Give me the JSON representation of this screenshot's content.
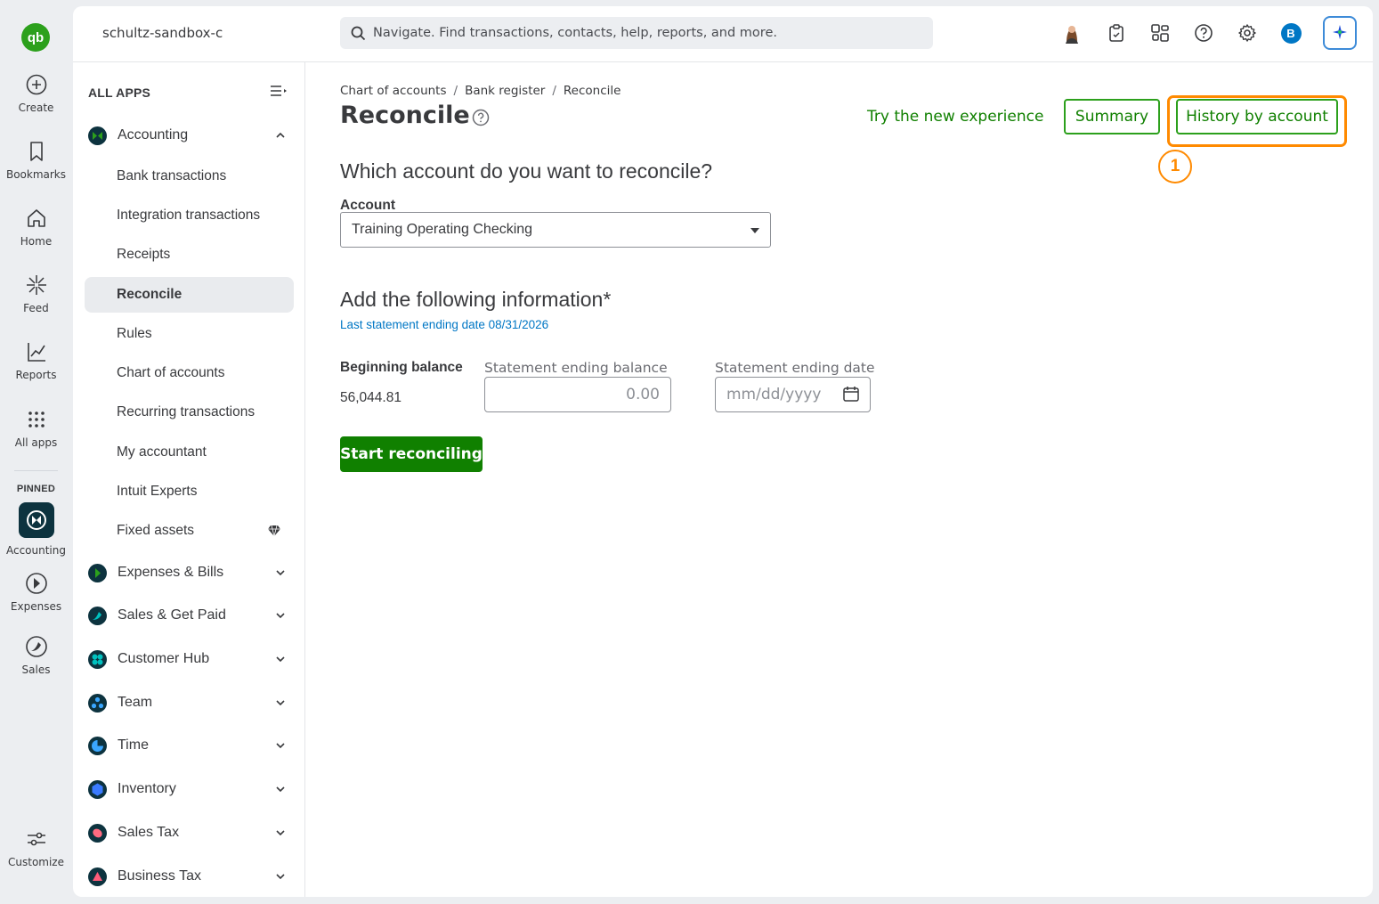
{
  "rail": {
    "logo": "qb",
    "items": [
      {
        "label": "Create",
        "icon": "plus-circle-icon"
      },
      {
        "label": "Bookmarks",
        "icon": "bookmark-icon"
      },
      {
        "label": "Home",
        "icon": "home-icon"
      },
      {
        "label": "Feed",
        "icon": "feed-icon"
      },
      {
        "label": "Reports",
        "icon": "reports-icon"
      },
      {
        "label": "All apps",
        "icon": "grid-icon"
      }
    ],
    "pinned_label": "PINNED",
    "pinned": [
      {
        "label": "Accounting",
        "icon": "accounting-icon"
      },
      {
        "label": "Expenses",
        "icon": "expenses-icon"
      },
      {
        "label": "Sales",
        "icon": "sales-icon"
      }
    ],
    "customize_label": "Customize"
  },
  "topbar": {
    "company": "schultz-sandbox-c",
    "search_placeholder": "Navigate. Find transactions, contacts, help, reports, and more.",
    "avatar_initial": "B"
  },
  "apps": {
    "heading": "ALL APPS",
    "accounting": {
      "label": "Accounting",
      "items": [
        "Bank transactions",
        "Integration transactions",
        "Receipts",
        "Reconcile",
        "Rules",
        "Chart of accounts",
        "Recurring transactions",
        "My accountant",
        "Intuit Experts",
        "Fixed assets"
      ],
      "active": "Reconcile"
    },
    "groups": [
      {
        "label": "Expenses & Bills",
        "color": "#2ca01c"
      },
      {
        "label": "Sales & Get Paid",
        "color": "#00a88f"
      },
      {
        "label": "Customer Hub",
        "color": "#00b3a4"
      },
      {
        "label": "Team",
        "color": "#0077c5"
      },
      {
        "label": "Time",
        "color": "#0097e6"
      },
      {
        "label": "Inventory",
        "color": "#2a5bd7"
      },
      {
        "label": "Sales Tax",
        "color": "#e8536b"
      },
      {
        "label": "Business Tax",
        "color": "#d8344f"
      }
    ]
  },
  "page": {
    "breadcrumbs": [
      "Chart of accounts",
      "Bank register",
      "Reconcile"
    ],
    "title": "Reconcile",
    "try_new": "Try the new experience",
    "summary_btn": "Summary",
    "history_btn": "History by account",
    "annotation_number": "1",
    "question": "Which account do you want to reconcile?",
    "account_label": "Account",
    "account_value": "Training Operating Checking",
    "add_info_heading": "Add the following information*",
    "last_statement": "Last statement ending date 08/31/2026",
    "beginning_balance_label": "Beginning balance",
    "beginning_balance_value": "56,044.81",
    "ending_balance_label": "Statement ending balance",
    "ending_balance_placeholder": "0.00",
    "ending_date_label": "Statement ending date",
    "ending_date_placeholder": "mm/dd/yyyy",
    "start_btn": "Start reconciling"
  },
  "colors": {
    "brand_green": "#2ca01c",
    "dark_green": "#108000",
    "link_blue": "#0077c5",
    "highlight_orange": "#ff8a00"
  }
}
